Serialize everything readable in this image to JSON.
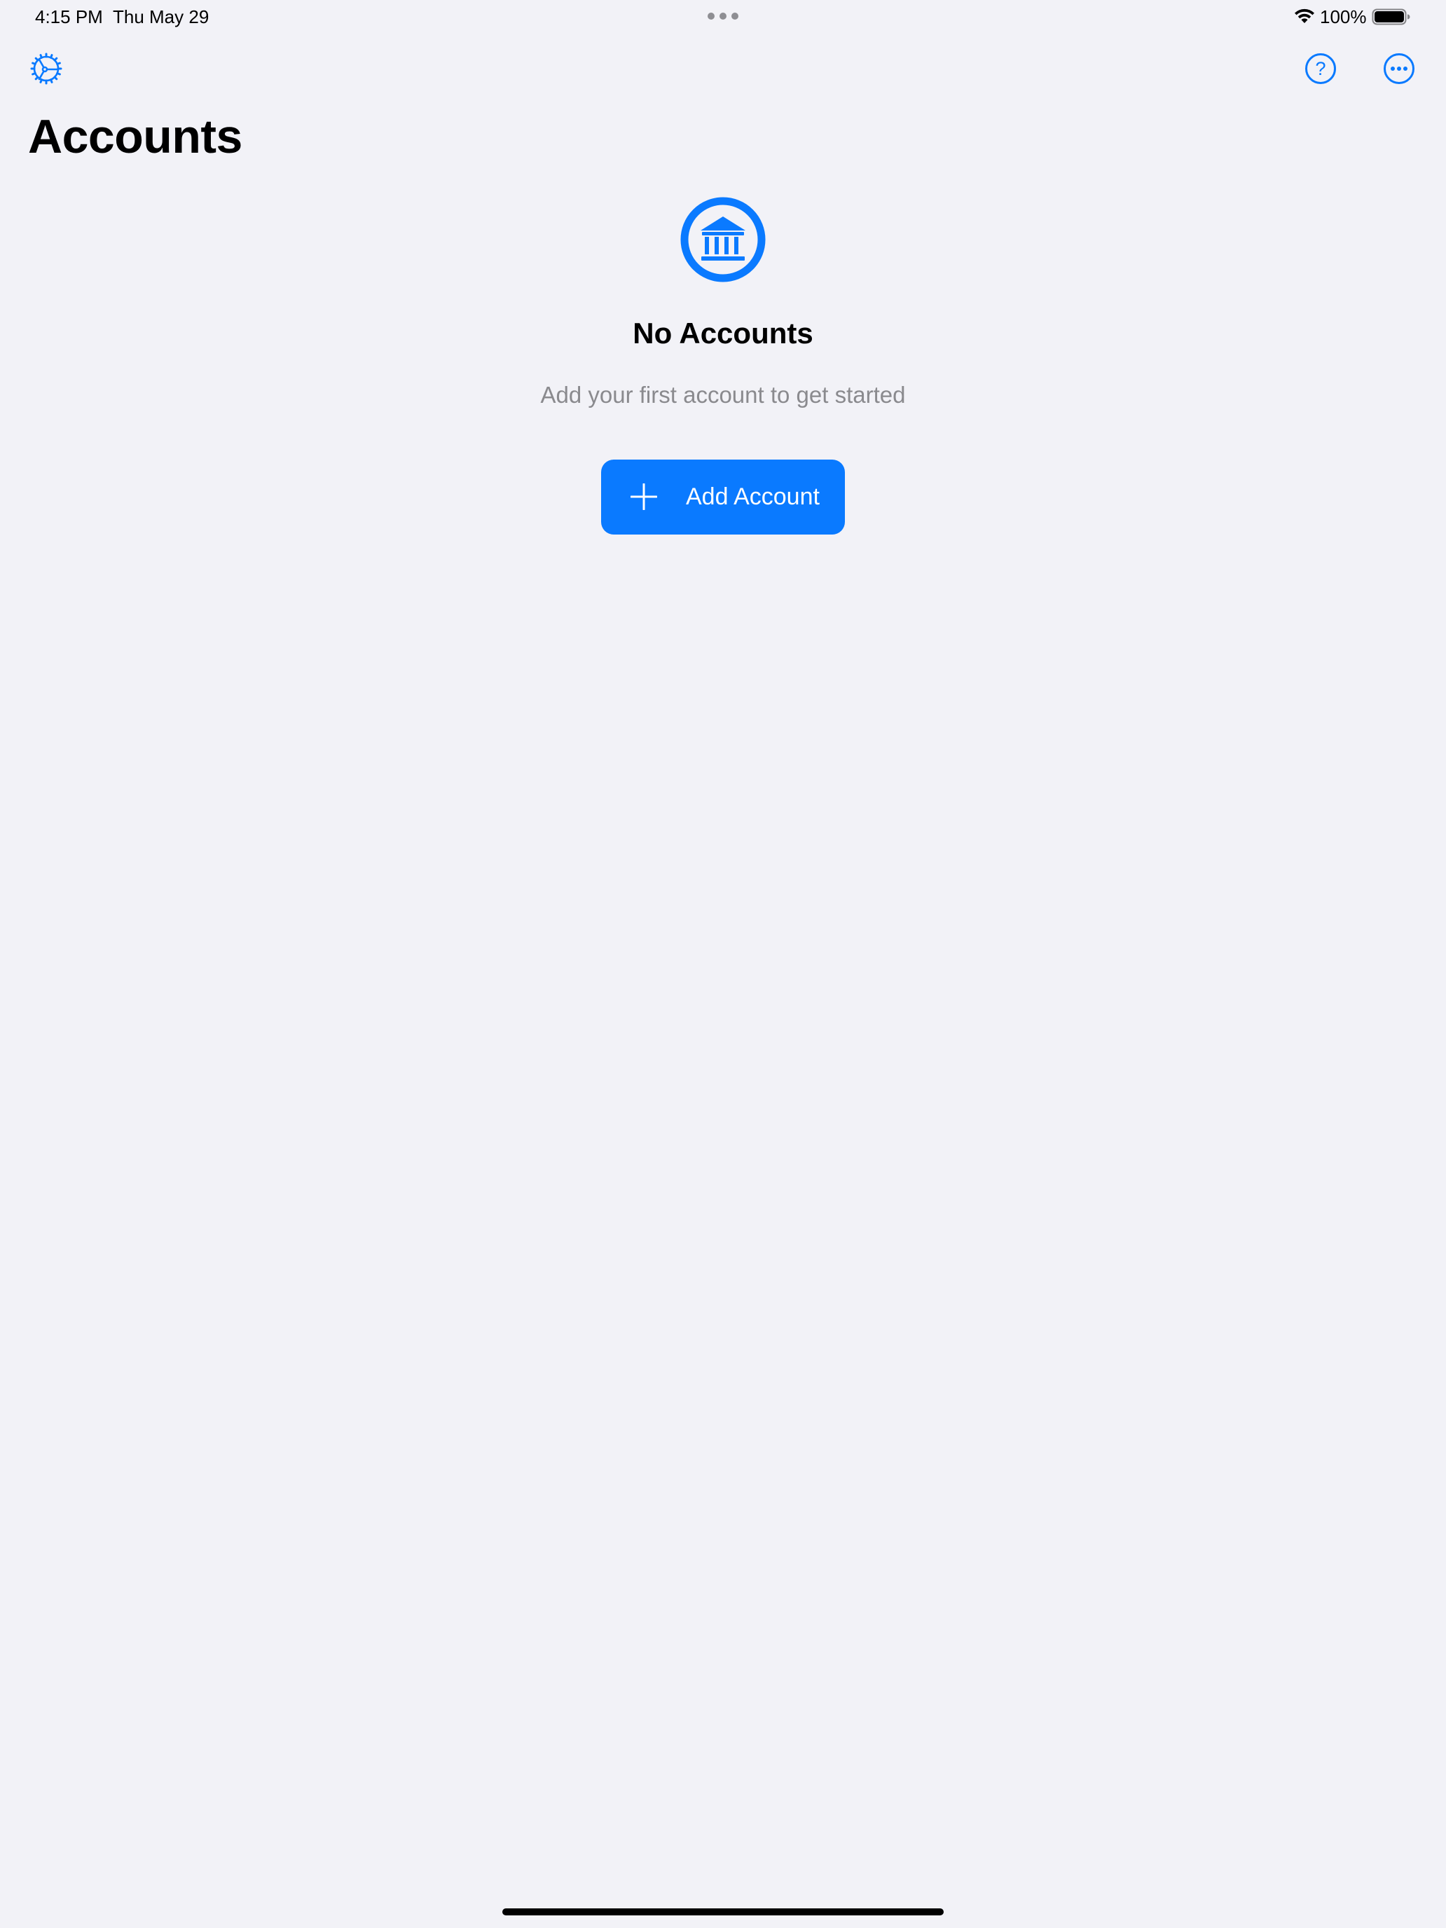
{
  "status_bar": {
    "time": "4:15 PM",
    "date": "Thu May 29",
    "battery_percent": "100%",
    "battery_level": 1.0
  },
  "toolbar": {
    "left_icon": "settings-gear-icon",
    "right_icons": [
      "help-icon",
      "more-icon"
    ]
  },
  "page": {
    "title": "Accounts"
  },
  "empty_state": {
    "icon": "bank-icon",
    "title": "No Accounts",
    "subtitle": "Add your first account to get started",
    "button_label": "Add Account",
    "button_icon": "plus-icon"
  },
  "colors": {
    "accent": "#0a7aff",
    "background": "#f2f2f7",
    "secondary_text": "#8a8a8e"
  }
}
